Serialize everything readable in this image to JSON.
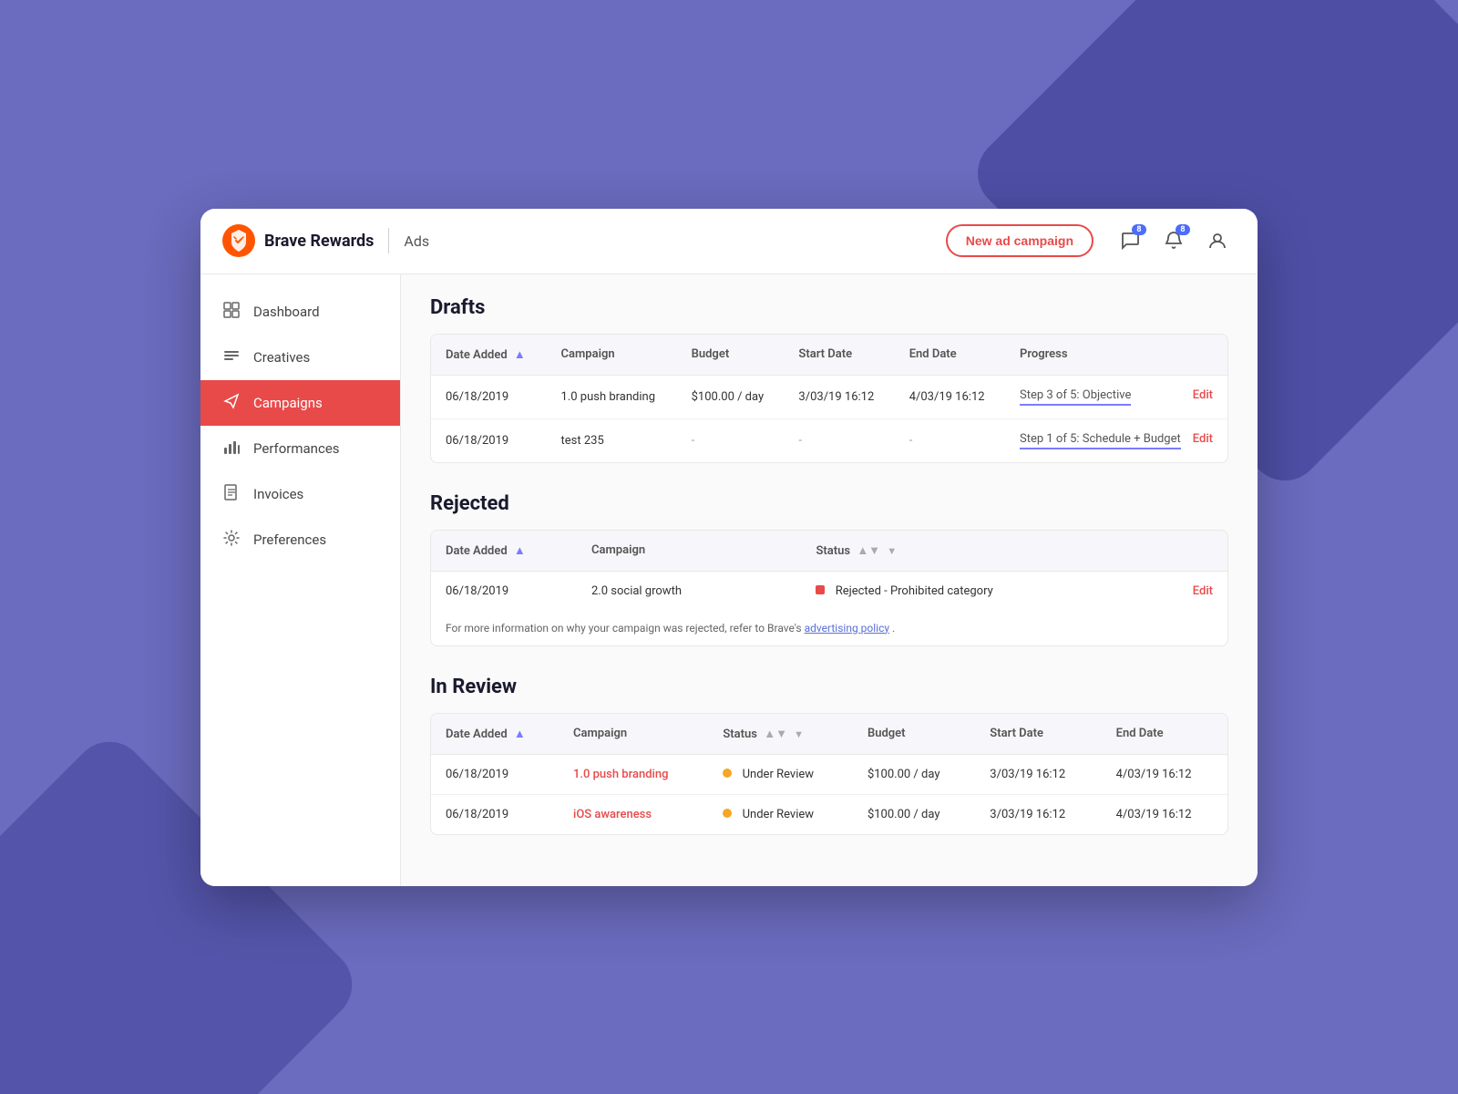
{
  "header": {
    "logo_text": "Brave Rewards",
    "section": "Ads",
    "new_campaign_label": "New ad campaign",
    "messages_badge": "8",
    "notifications_badge": "8"
  },
  "sidebar": {
    "items": [
      {
        "id": "dashboard",
        "label": "Dashboard",
        "icon": "⊞",
        "active": false
      },
      {
        "id": "creatives",
        "label": "Creatives",
        "icon": "≡",
        "active": false
      },
      {
        "id": "campaigns",
        "label": "Campaigns",
        "icon": "➤",
        "active": true
      },
      {
        "id": "performances",
        "label": "Performances",
        "icon": "📊",
        "active": false
      },
      {
        "id": "invoices",
        "label": "Invoices",
        "icon": "🧾",
        "active": false
      },
      {
        "id": "preferences",
        "label": "Preferences",
        "icon": "⚙",
        "active": false
      }
    ]
  },
  "drafts": {
    "title": "Drafts",
    "columns": [
      "Date Added",
      "Campaign",
      "Budget",
      "Start Date",
      "End Date",
      "Progress"
    ],
    "rows": [
      {
        "date_added": "06/18/2019",
        "campaign": "1.0 push branding",
        "budget": "$100.00 / day",
        "start_date": "3/03/19 16:12",
        "end_date": "4/03/19 16:12",
        "progress": "Step 3 of 5: Objective",
        "action": "Edit"
      },
      {
        "date_added": "06/18/2019",
        "campaign": "test 235",
        "budget": "-",
        "start_date": "-",
        "end_date": "-",
        "progress": "Step 1 of 5: Schedule + Budget",
        "action": "Edit"
      }
    ]
  },
  "rejected": {
    "title": "Rejected",
    "columns": [
      "Date Added",
      "Campaign",
      "Status"
    ],
    "rows": [
      {
        "date_added": "06/18/2019",
        "campaign": "2.0 social growth",
        "status": "Rejected - Prohibited category",
        "status_type": "red",
        "action": "Edit"
      }
    ],
    "note_prefix": "For more information on why your campaign was rejected, refer to Brave's ",
    "note_link": "advertising policy",
    "note_suffix": "."
  },
  "in_review": {
    "title": "In Review",
    "columns": [
      "Date Added",
      "Campaign",
      "Status",
      "Budget",
      "Start Date",
      "End Date"
    ],
    "rows": [
      {
        "date_added": "06/18/2019",
        "campaign": "1.0 push branding",
        "status": "Under Review",
        "status_type": "yellow",
        "budget": "$100.00 / day",
        "start_date": "3/03/19 16:12",
        "end_date": "4/03/19 16:12"
      },
      {
        "date_added": "06/18/2019",
        "campaign": "iOS awareness",
        "status": "Under Review",
        "status_type": "yellow",
        "budget": "$100.00 / day",
        "start_date": "3/03/19 16:12",
        "end_date": "4/03/19 16:12"
      }
    ]
  }
}
